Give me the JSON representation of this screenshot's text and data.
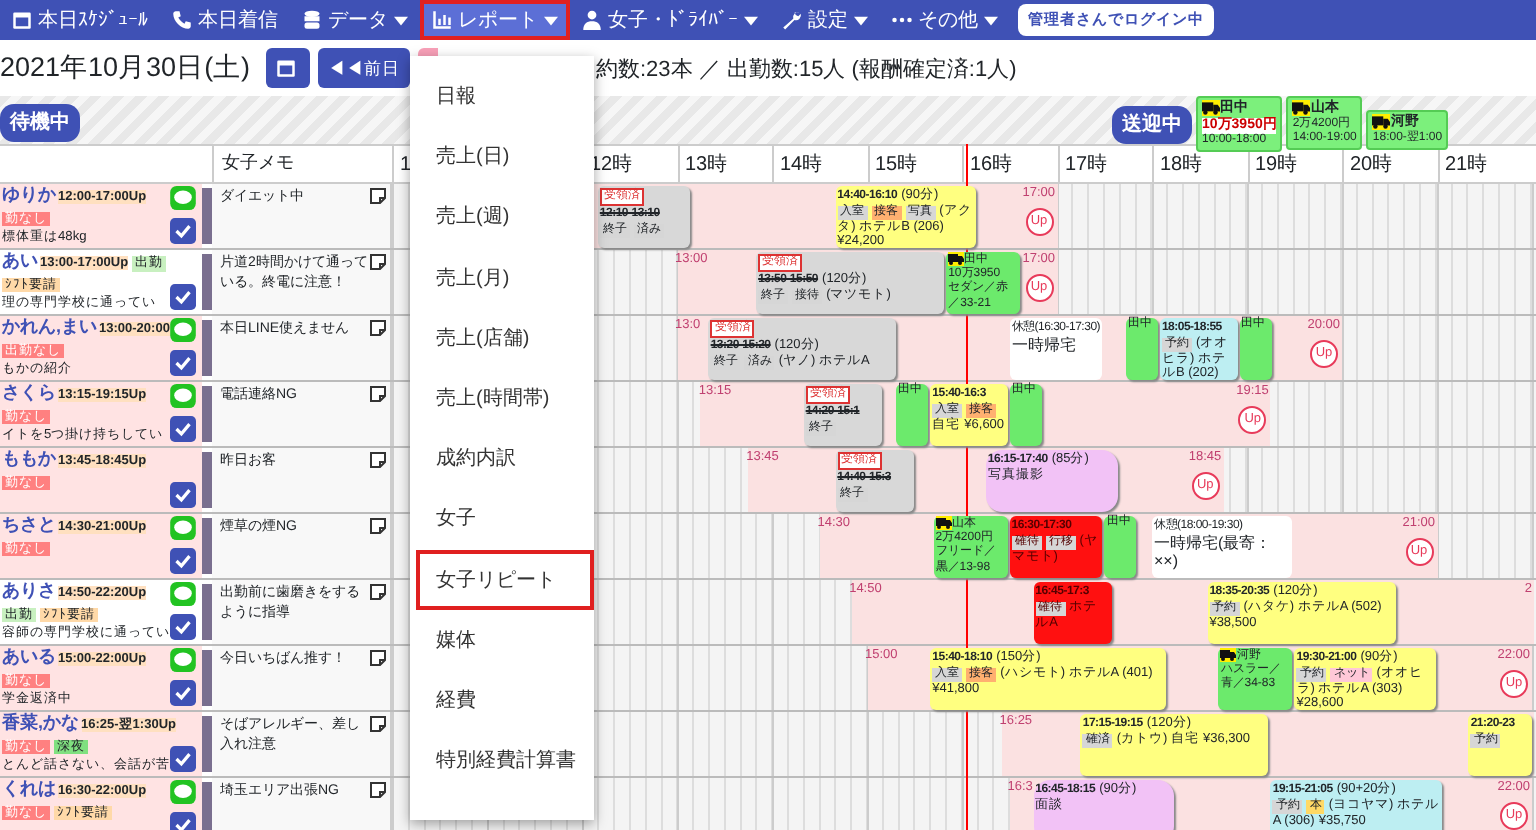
{
  "navbar": {
    "items": [
      {
        "label": "本日ｽｹｼﾞｭｰﾙ",
        "caret": false,
        "selected": false
      },
      {
        "label": "本日着信",
        "caret": false,
        "selected": false
      },
      {
        "label": "データ",
        "caret": true,
        "selected": false
      },
      {
        "label": "レポート",
        "caret": true,
        "selected": true
      },
      {
        "label": "女子・ﾄﾞﾗｲﾊﾞｰ",
        "caret": true,
        "selected": false
      },
      {
        "label": "設定",
        "caret": true,
        "selected": false
      },
      {
        "label": "その他",
        "caret": true,
        "selected": false
      }
    ],
    "login_badge": "管理者さんでログイン中"
  },
  "toolbar": {
    "date": "2021年10月30日(土)",
    "prev_button": "◀◀前日",
    "stats": "約数:23本 ／ 出勤数:15人 (報酬確定済:1人)"
  },
  "status_bar": {
    "waiting_label": "待機中",
    "transit_label": "送迎中",
    "drivers": [
      {
        "name": "田中",
        "earnings": "10万3950円",
        "highlight": true,
        "hours": "10:00-18:00"
      },
      {
        "name": "山本",
        "earnings": "2万4200円",
        "highlight": false,
        "hours": "14:00-19:00"
      },
      {
        "name": "河野",
        "hours": "18:00-翌1:00"
      }
    ]
  },
  "table": {
    "memo_heading": "女子メモ",
    "hours": [
      "1",
      "12時",
      "13時",
      "14時",
      "15時",
      "16時",
      "17時",
      "18時",
      "19時",
      "20時",
      "21時"
    ],
    "rows": [
      {
        "name": "ゆりか",
        "shift": "12:00-17:00Up",
        "attended": false,
        "line": true,
        "tags": [
          {
            "label": "勤なし",
            "color": "#ff8080"
          }
        ],
        "note": "標体重は48kg",
        "memo": "ダイエット中",
        "end_label": "17:00",
        "end_mark": "Up",
        "items": [
          {
            "kind": "done",
            "badge": "受領済",
            "time": "12:10-13:10",
            "tags": [
              {
                "label": "終子",
                "color": "#d6d6d6"
              },
              {
                "label": "済み",
                "color": "#d6d6d6"
              }
            ]
          },
          {
            "kind": "active",
            "time": "14:40-16:10",
            "duration": "(90分)",
            "tags": [
              {
                "label": "入室",
                "color": "#d6d6d6"
              },
              {
                "label": "接客",
                "color": "#ffb070"
              },
              {
                "label": "写真",
                "color": "#d6d6d6"
              }
            ],
            "text": "(アクタ) ホテルB (206)",
            "price": "¥24,200"
          }
        ]
      },
      {
        "name": "あい",
        "shift": "13:00-17:00Up",
        "attended": true,
        "line": false,
        "inline_tag": {
          "label": "出勤",
          "color": "#c8f0c0"
        },
        "tags": [
          {
            "label": "ｼﾌﾄ要請",
            "color": "#ffd9a8"
          }
        ],
        "note": "理の専門学校に通ってい",
        "memo": "片道2時間かけて通っている。終電に注意！",
        "start_label": "13:00",
        "end_label": "17:00",
        "end_mark": "Up",
        "items": [
          {
            "kind": "done",
            "badge": "受領済",
            "time": "13:50-15:50",
            "duration": "(120分)",
            "tags": [
              {
                "label": "終子",
                "color": "#d6d6d6"
              },
              {
                "label": "接待",
                "color": "#d6d6d6"
              }
            ],
            "text": "(マツモト)"
          },
          {
            "kind": "pick",
            "name": "田中",
            "price": "10万3950",
            "text": "セダン／赤／33-21"
          }
        ]
      },
      {
        "name": "かれん,まい",
        "shift": "13:00-20:00",
        "attended": false,
        "line": true,
        "tags": [
          {
            "label": "出勤なし",
            "color": "#ff8080"
          }
        ],
        "note": "もかの紹介",
        "memo": "本日LINE使えません",
        "start_label": "13:0",
        "end_label": "20:00",
        "end_mark": "Up",
        "items": [
          {
            "kind": "done",
            "badge": "受領済",
            "time": "13:20-15:20",
            "duration": "(120分)",
            "tags": [
              {
                "label": "終子",
                "color": "#d6d6d6"
              },
              {
                "label": "済み",
                "color": "#d6d6d6"
              }
            ],
            "text": "(ヤノ) ホテルA"
          },
          {
            "kind": "rest",
            "time": "休憩(16:30-17:30)",
            "text": "一時帰宅"
          },
          {
            "kind": "drop",
            "name": "田中"
          },
          {
            "kind": "reserved",
            "time": "18:05-18:55",
            "tags": [
              {
                "label": "予約",
                "color": "#d6d6d6"
              }
            ],
            "text": "(オオヒラ) ホテルB (202)"
          },
          {
            "kind": "pick",
            "name": "田中"
          }
        ]
      },
      {
        "name": "さくら",
        "shift": "13:15-19:15Up",
        "attended": false,
        "line": true,
        "tags": [
          {
            "label": "勤なし",
            "color": "#ff8080"
          }
        ],
        "note": "イトを5つ掛け持ちしてい",
        "memo": "電話連絡NG",
        "start_label": "13:15",
        "end_label": "19:15",
        "end_mark": "Up",
        "items": [
          {
            "kind": "done",
            "badge": "受領済",
            "time": "14:20-15:1",
            "tags": [
              {
                "label": "終子",
                "color": "#d6d6d6"
              }
            ]
          },
          {
            "kind": "drop",
            "name": "田中"
          },
          {
            "kind": "active",
            "time": "15:40-16:3",
            "tags": [
              {
                "label": "入室",
                "color": "#d6d6d6"
              },
              {
                "label": "接客",
                "color": "#ffb070"
              }
            ],
            "text": "自宅",
            "price": "¥6,600"
          },
          {
            "kind": "pick",
            "name": "田中"
          }
        ]
      },
      {
        "name": "ももか",
        "shift": "13:45-18:45Up",
        "attended": false,
        "line": false,
        "tags": [
          {
            "label": "勤なし",
            "color": "#ff8080"
          }
        ],
        "memo": "昨日お客",
        "start_label": "13:45",
        "end_label": "18:45",
        "end_mark": "Up",
        "items": [
          {
            "kind": "done",
            "badge": "受領済",
            "time": "14:40-15:3",
            "tags": [
              {
                "label": "終子",
                "color": "#d6d6d6"
              }
            ]
          },
          {
            "kind": "photo",
            "time": "16:15-17:40",
            "duration": "(85分)",
            "text": "写真撮影"
          }
        ]
      },
      {
        "name": "ちさと",
        "shift": "14:30-21:00Up",
        "attended": false,
        "line": true,
        "tags": [
          {
            "label": "勤なし",
            "color": "#ff8080"
          }
        ],
        "memo": "煙草の煙NG",
        "start_label": "14:30",
        "end_label": "21:00",
        "end_mark": "Up",
        "items": [
          {
            "kind": "drop",
            "name": "山本",
            "price": "2万4200円",
            "text": "フリード／黒／13-98"
          },
          {
            "kind": "confirmed",
            "time": "16:30-17:30",
            "tags": [
              {
                "label": "確待",
                "color": "#d6d6d6"
              },
              {
                "label": "行移",
                "color": "#d6d6d6"
              }
            ],
            "text": "(ヤマモト)"
          },
          {
            "kind": "pick",
            "name": "田中"
          },
          {
            "kind": "rest",
            "time": "休憩(18:00-19:30)",
            "text": "一時帰宅(最寄：××)"
          }
        ]
      },
      {
        "name": "ありさ",
        "shift": "14:50-22:20Up",
        "attended": true,
        "line": true,
        "tags": [
          {
            "label": "出勤",
            "color": "#c8f0c0"
          },
          {
            "label": "ｼﾌﾄ要請",
            "color": "#ffd9a8"
          }
        ],
        "note": "容師の専門学校に通ってい",
        "memo": "出勤前に歯磨きをするように指導",
        "start_label": "14:50",
        "end_label": "2",
        "items": [
          {
            "kind": "confirmed",
            "time": "16:45-17:3",
            "tags": [
              {
                "label": "確待",
                "color": "#d6d6d6"
              }
            ],
            "text": "ホテルA"
          },
          {
            "kind": "active",
            "time": "18:35-20:35",
            "duration": "(120分)",
            "tags": [
              {
                "label": "予約",
                "color": "#d6d6d6"
              }
            ],
            "text": "(ハタケ) ホテルA (502)",
            "price": "¥38,500"
          }
        ]
      },
      {
        "name": "あいる",
        "shift": "15:00-22:00Up",
        "attended": false,
        "line": true,
        "tags": [
          {
            "label": "勤なし",
            "color": "#ff8080"
          }
        ],
        "note": "学金返済中",
        "memo": "今日いちばん推す！",
        "start_label": "15:00",
        "end_label": "22:00",
        "end_mark": "Up",
        "items": [
          {
            "kind": "active",
            "time": "15:40-18:10",
            "duration": "(150分)",
            "tags": [
              {
                "label": "入室",
                "color": "#d6d6d6"
              },
              {
                "label": "接客",
                "color": "#ffb070"
              }
            ],
            "text": "(ハシモト) ホテルA (401)",
            "price": "¥41,800"
          },
          {
            "kind": "drop",
            "name": "河野",
            "text": "ハスラー／青／34-83"
          },
          {
            "kind": "active",
            "time": "19:30-21:00",
            "duration": "(90分)",
            "tags": [
              {
                "label": "予約",
                "color": "#d6d6d6"
              },
              {
                "label": "ネット",
                "color": "#ffc8d8"
              }
            ],
            "text": "(オオヒラ) ホテルA (303)",
            "price": "¥28,600"
          }
        ]
      },
      {
        "name": "香菜,かな",
        "shift": "16:25-翌1:30Up",
        "attended": false,
        "line": false,
        "tags": [
          {
            "label": "勤なし",
            "color": "#ff8080"
          },
          {
            "label": "深夜",
            "color": "#80e080"
          }
        ],
        "note": "とんど話さない、会話が苦",
        "memo": "そばアレルギー、差し入れ注意",
        "start_label": "16:25",
        "items": [
          {
            "kind": "active",
            "time": "17:15-19:15",
            "duration": "(120分)",
            "tags": [
              {
                "label": "確済",
                "color": "#d6d6d6"
              }
            ],
            "text": "(カトウ) 自宅",
            "price": "¥36,300"
          },
          {
            "kind": "active",
            "time": "21:20-23",
            "tags": [
              {
                "label": "予約",
                "color": "#d6d6d6"
              }
            ]
          }
        ]
      },
      {
        "name": "くれは",
        "shift": "16:30-22:00Up",
        "attended": false,
        "line": true,
        "tags": [
          {
            "label": "勤なし",
            "color": "#ff8080"
          },
          {
            "label": "ｼﾌﾄ要請",
            "color": "#ffd9a8"
          }
        ],
        "memo": "埼玉エリア出張NG",
        "start_label": "16:3",
        "end_label": "22:00",
        "end_mark": "Up",
        "items": [
          {
            "kind": "photo",
            "time": "16:45-18:15",
            "duration": "(90分)",
            "text": "面談"
          },
          {
            "kind": "reserved",
            "time": "19:15-21:05",
            "duration": "(90+20分)",
            "tags": [
              {
                "label": "予約",
                "color": "#d6d6d6"
              },
              {
                "label": "本",
                "color": "#ffd966"
              }
            ],
            "text": "(ヨコヤマ) ホテルA (306)",
            "price": "¥35,750"
          }
        ]
      }
    ]
  },
  "report_menu": {
    "items": [
      {
        "label": "日報",
        "selected": false
      },
      {
        "label": "売上(日)",
        "selected": false
      },
      {
        "label": "売上(週)",
        "selected": false
      },
      {
        "label": "売上(月)",
        "selected": false
      },
      {
        "label": "売上(店舗)",
        "selected": false
      },
      {
        "label": "売上(時間帯)",
        "selected": false
      },
      {
        "label": "成約内訳",
        "selected": false
      },
      {
        "label": "女子",
        "selected": false
      },
      {
        "label": "女子リピート",
        "selected": true
      },
      {
        "label": "媒体",
        "selected": false
      },
      {
        "label": "経費",
        "selected": false
      },
      {
        "label": "特別経費計算書",
        "selected": false
      }
    ]
  }
}
